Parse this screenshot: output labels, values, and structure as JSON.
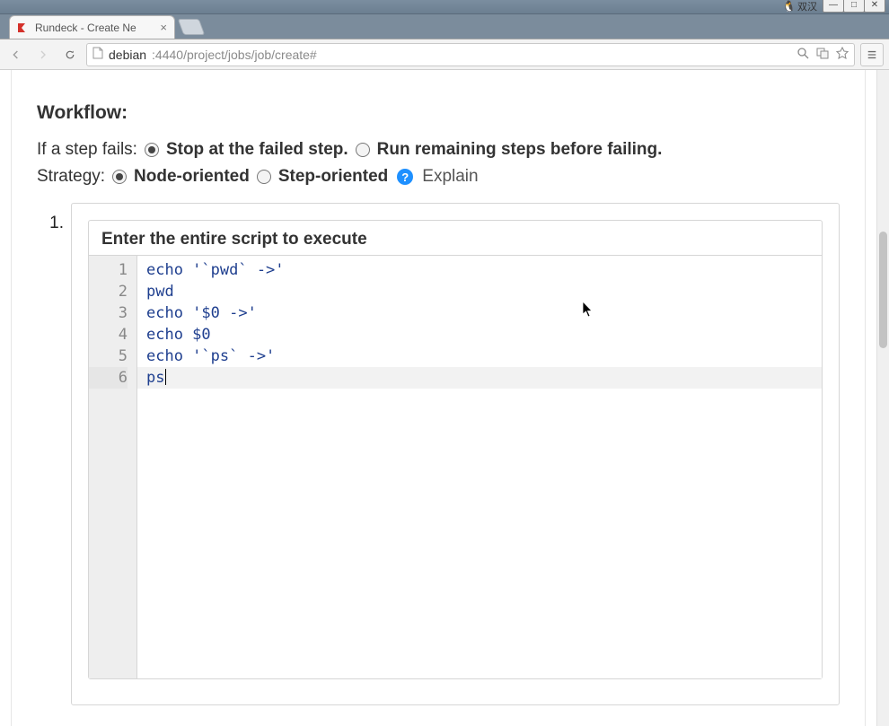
{
  "os": {
    "tray_text": "双汉",
    "win_min": "—",
    "win_max": "□",
    "win_close": "✕"
  },
  "browser": {
    "tab_title": "Rundeck - Create Ne",
    "url_host": "debian",
    "url_rest": ":4440/project/jobs/job/create#"
  },
  "workflow": {
    "heading": "Workflow:",
    "fail_label": "If a step fails:",
    "fail_opt_stop": "Stop at the failed step.",
    "fail_opt_continue": "Run remaining steps before failing.",
    "fail_selected": "stop",
    "strategy_label": "Strategy:",
    "strategy_opt_node": "Node-oriented",
    "strategy_opt_step": "Step-oriented",
    "strategy_selected": "node",
    "explain": "Explain"
  },
  "step": {
    "number": "1.",
    "script_heading": "Enter the entire script to execute",
    "lines": [
      "echo '`pwd` ->'",
      "pwd",
      "echo '$0 ->'",
      "echo $0",
      "echo '`ps` ->'",
      "ps"
    ],
    "active_line_index": 5
  }
}
